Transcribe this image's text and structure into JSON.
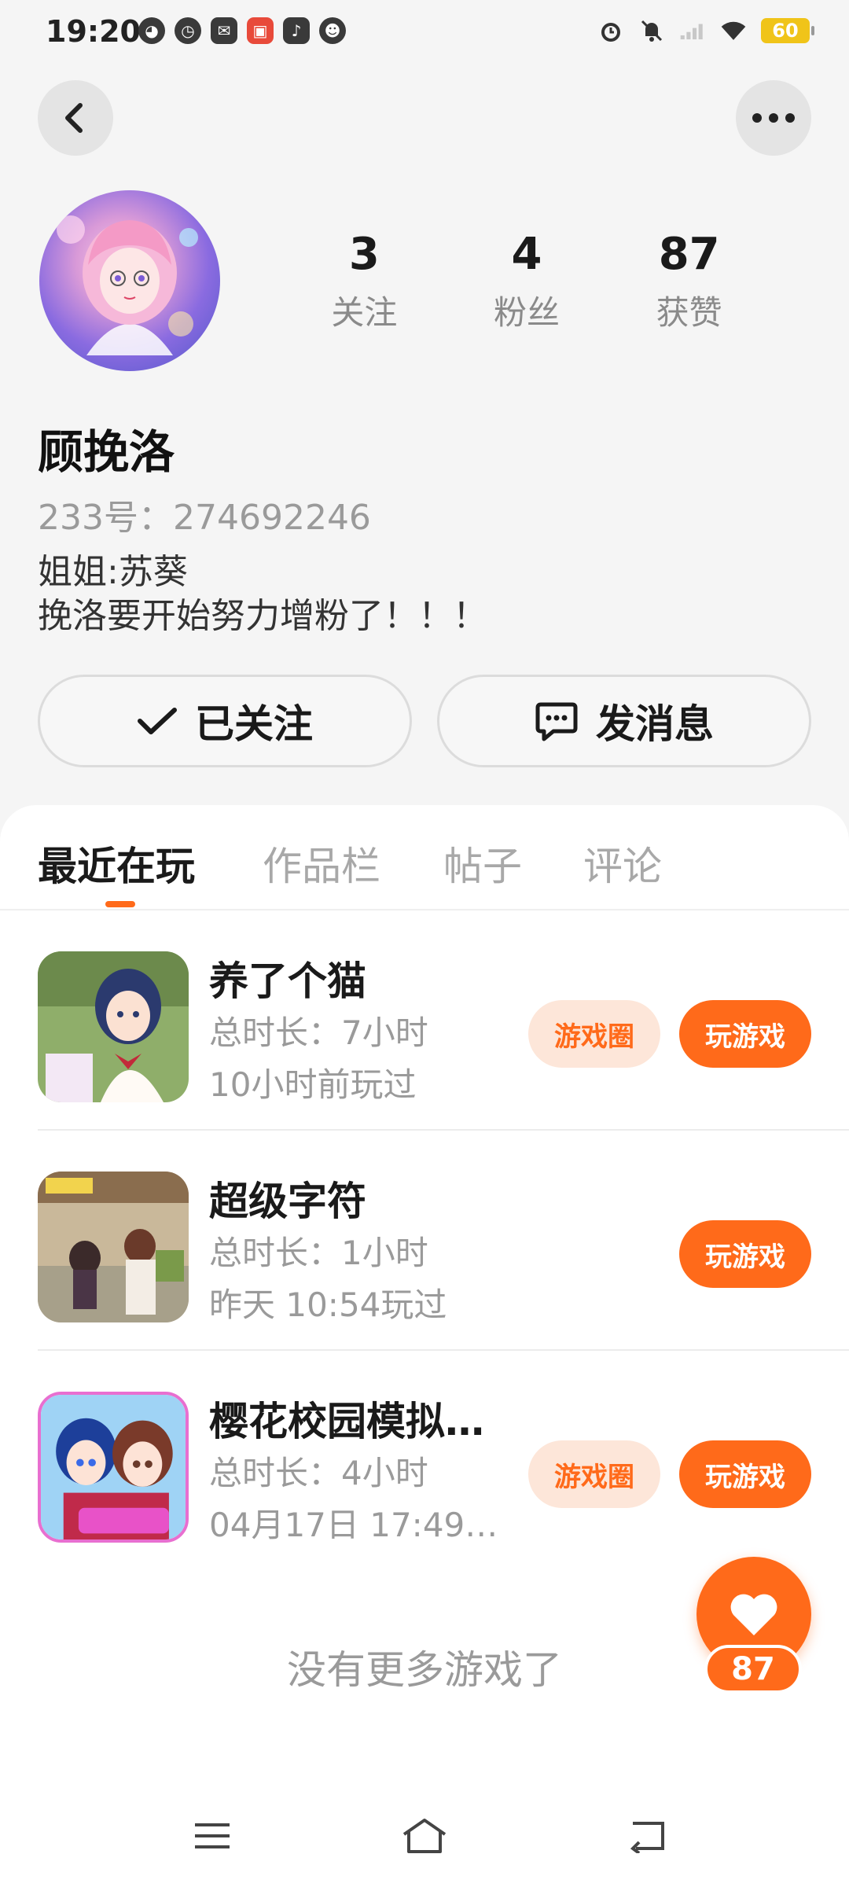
{
  "status_bar": {
    "time": "19:20",
    "battery": "60",
    "left_icons": [
      "cat-face-icon",
      "compass-icon",
      "mail-icon",
      "app-icon",
      "music-icon",
      "bot-icon"
    ],
    "right_icons": [
      "alarm-icon",
      "mute-icon",
      "signal-icon",
      "wifi-icon",
      "battery-icon"
    ]
  },
  "profile": {
    "name": "顾挽洛",
    "id_line": "233号：274692246",
    "bio": [
      "姐姐:苏葵",
      "挽洛要开始努力增粉了！！！"
    ],
    "stats": [
      {
        "value": "3",
        "label": "关注"
      },
      {
        "value": "4",
        "label": "粉丝"
      },
      {
        "value": "87",
        "label": "获赞"
      }
    ]
  },
  "actions": {
    "follow_label": "已关注",
    "message_label": "发消息"
  },
  "tabs": [
    "最近在玩",
    "作品栏",
    "帖子",
    "评论"
  ],
  "active_tab": 0,
  "games": [
    {
      "title": "养了个猫",
      "duration": "总时长：7小时",
      "last_played": "10小时前玩过",
      "has_circle": true,
      "circle_label": "游戏圈",
      "play_label": "玩游戏"
    },
    {
      "title": "超级字符",
      "duration": "总时长：1小时",
      "last_played": "昨天 10:54玩过",
      "has_circle": false,
      "play_label": "玩游戏"
    },
    {
      "title": "樱花校园模拟…",
      "duration": "总时长：4小时",
      "last_played": "04月17日 17:49…",
      "has_circle": true,
      "circle_label": "游戏圈",
      "play_label": "玩游戏"
    }
  ],
  "footer_text": "没有更多游戏了",
  "like": {
    "count": "87"
  },
  "colors": {
    "accent": "#ff6a1a",
    "accent_light": "#fde6d9",
    "background": "#f5f5f5"
  }
}
